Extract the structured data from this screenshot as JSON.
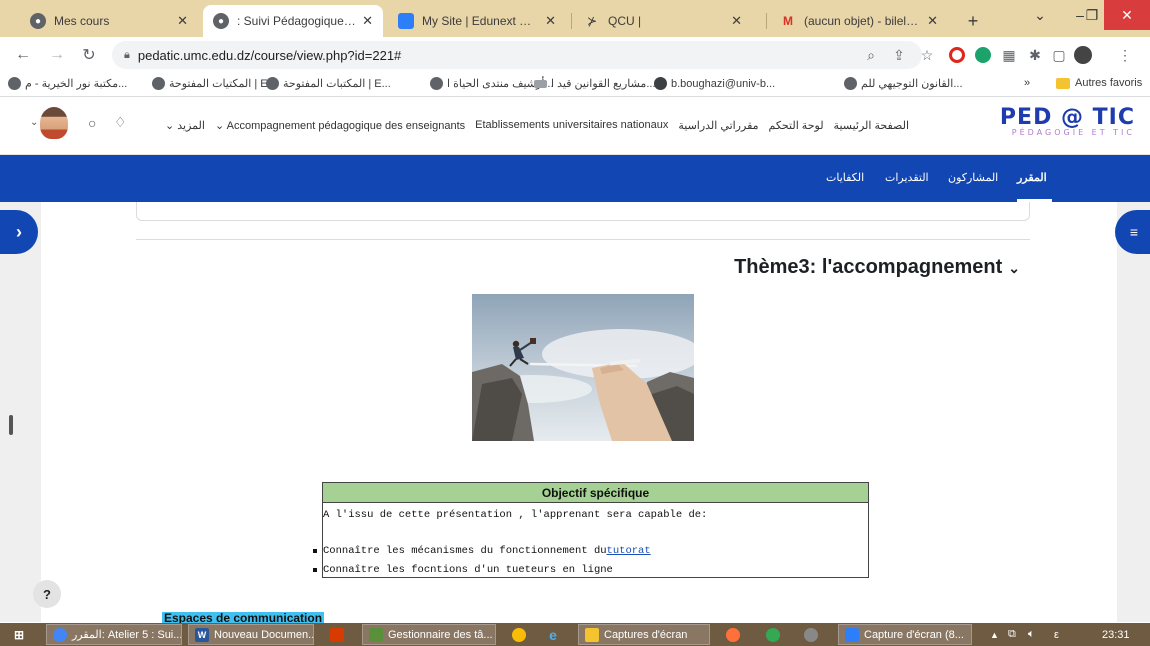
{
  "browser": {
    "tabs": [
      {
        "title": "Mes cours",
        "active": false
      },
      {
        "title": ": Suivi Pédagogique :المقرر",
        "active": true
      },
      {
        "title": "My Site | Edunext Control C",
        "active": false
      },
      {
        "title": "QCU |",
        "active": false
      },
      {
        "title": "(aucun objet) - bileloss211",
        "active": false
      }
    ],
    "new_tab_symbol": "+",
    "url": "pedatic.umc.edu.dz/course/view.php?id=221#",
    "bookmarks": [
      "مكتبة نور الخيرية - م...",
      "المكتيات المفتوحة | E...",
      "المكتبات المفتوحة | E...",
      "أرشيف منتدى الحياة ا...",
      "مشاريع القوانين قيد ا...",
      "b.boughazi@univ-b...",
      "القانون التوجيهي للم...",
      "»",
      "Autres favoris"
    ]
  },
  "site": {
    "nav": [
      "المزيد",
      "Accompagnement pédagogique des enseignants",
      "Etablissements universitaires nationaux",
      "مقرراتي الدراسية",
      "لوحة التحكم",
      "الصفحة الرئيسية"
    ],
    "logo_line1": "PED @ TIC",
    "logo_line2": "PÉDAGOGIE ET TIC",
    "course_nav": [
      "المقرر",
      "المشاركون",
      "التقديرات",
      "الكفايات"
    ]
  },
  "content": {
    "section_title": "Thème3: l'accompagnement",
    "objective": {
      "header": "Objectif spécifique",
      "intro": "A  l'issu de cette présentation ,  l'apprenant sera capable de:",
      "item1_prefix": "Connaître les mécanismes du fonctionnement du ",
      "item1_link": "tutorat",
      "item2": "Connaître les focntions d'un tueteurs en ligne"
    },
    "next_section_title": "Espaces de communication",
    "help_label": "?"
  },
  "taskbar": {
    "items": [
      "المقرر: Atelier 5 : Sui...",
      "Nouveau Documen...",
      "Gestionnaire des tâ...",
      "Captures d'écran",
      "Capture d'écran (8..."
    ],
    "lang": "ε",
    "time": "23:31"
  },
  "colors": {
    "brand_blue": "#1146b3",
    "tabstrip": "#e8d5a8",
    "objective_header": "#a5d194",
    "taskbar": "#6f5a42"
  }
}
